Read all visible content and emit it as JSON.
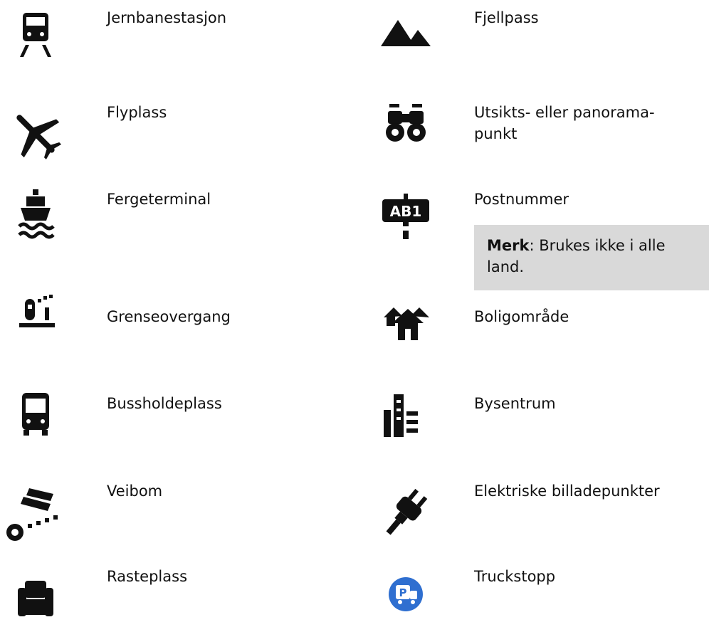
{
  "left_column": [
    {
      "label": "Jernbanestasjon",
      "icon": "train-icon"
    },
    {
      "label": "Flyplass",
      "icon": "airplane-icon"
    },
    {
      "label": "Fergeterminal",
      "icon": "ferry-icon"
    },
    {
      "label": "Grenseovergang",
      "icon": "border-crossing-icon"
    },
    {
      "label": "Bussholdeplass",
      "icon": "bus-icon"
    },
    {
      "label": "Veibom",
      "icon": "toll-barrier-icon"
    },
    {
      "label": "Rasteplass",
      "icon": "rest-area-icon"
    }
  ],
  "right_column": [
    {
      "label": "Fjellpass",
      "icon": "mountain-pass-icon"
    },
    {
      "label": "Utsikts- eller panorama-punkt",
      "icon": "binoculars-icon"
    },
    {
      "label": "Postnummer",
      "icon": "postcode-sign-icon"
    },
    {
      "label": "Boligområde",
      "icon": "residential-houses-icon"
    },
    {
      "label": "Bysentrum",
      "icon": "city-center-icon"
    },
    {
      "label": "Elektriske billadepunkter",
      "icon": "ev-plug-icon"
    },
    {
      "label": "Truckstopp",
      "icon": "truck-stop-icon"
    }
  ],
  "note": {
    "prefix": "Merk",
    "text": ": Brukes ikke i alle land."
  },
  "colors": {
    "icon": "#111111",
    "note_background": "#d9d9d9",
    "truck_stop_blue": "#2f6fd0"
  }
}
